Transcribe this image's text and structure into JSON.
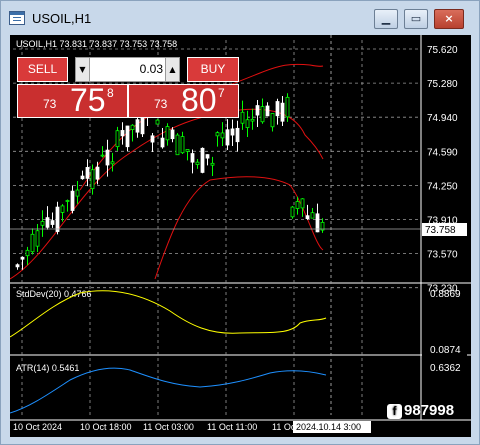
{
  "window": {
    "title": "USOIL,H1"
  },
  "chart_header": {
    "symbol_info": "USOIL,H1  73.831 73.837 73.753 73.758"
  },
  "trade_panel": {
    "sell_label": "SELL",
    "buy_label": "BUY",
    "lot_value": "0.03",
    "sell_quote": {
      "prefix": "73",
      "main": "75",
      "sup": "8"
    },
    "buy_quote": {
      "prefix": "73",
      "main": "80",
      "sup": "7"
    }
  },
  "price_axis": {
    "ticks": [
      "75.620",
      "75.280",
      "74.940",
      "74.590",
      "74.250",
      "73.910",
      "73.570",
      "73.230"
    ],
    "current": "73.758"
  },
  "stddev": {
    "label": "StdDev(20) 0.4766",
    "top": "0.8869",
    "bottom": "0.0874"
  },
  "atr": {
    "label": "ATR(14) 0.5461",
    "top": "0.6362"
  },
  "time_axis": {
    "labels": [
      "10 Oct 2024",
      "10 Oct 18:00",
      "11 Oct 03:00",
      "11 Oct 11:00",
      "11 Oct 19:00"
    ],
    "highlight": "2024.10.14 3:00"
  },
  "watermark": {
    "text": "987998"
  },
  "colors": {
    "bull": "#00ff00",
    "bear": "#ffffff",
    "bands": "#ff0000",
    "stddev": "#ffff00",
    "atr": "#1e90ff"
  },
  "chart_data": {
    "type": "line",
    "x": [
      "10 Oct 2024",
      "10 Oct 18:00",
      "11 Oct 03:00",
      "11 Oct 11:00",
      "11 Oct 19:00"
    ],
    "series": [
      {
        "name": "StdDev(20)",
        "values": [
          0.18,
          0.82,
          0.62,
          0.31,
          0.42
        ]
      },
      {
        "name": "ATR(14)",
        "values": [
          0.3,
          0.62,
          0.52,
          0.57,
          0.55
        ]
      }
    ]
  }
}
